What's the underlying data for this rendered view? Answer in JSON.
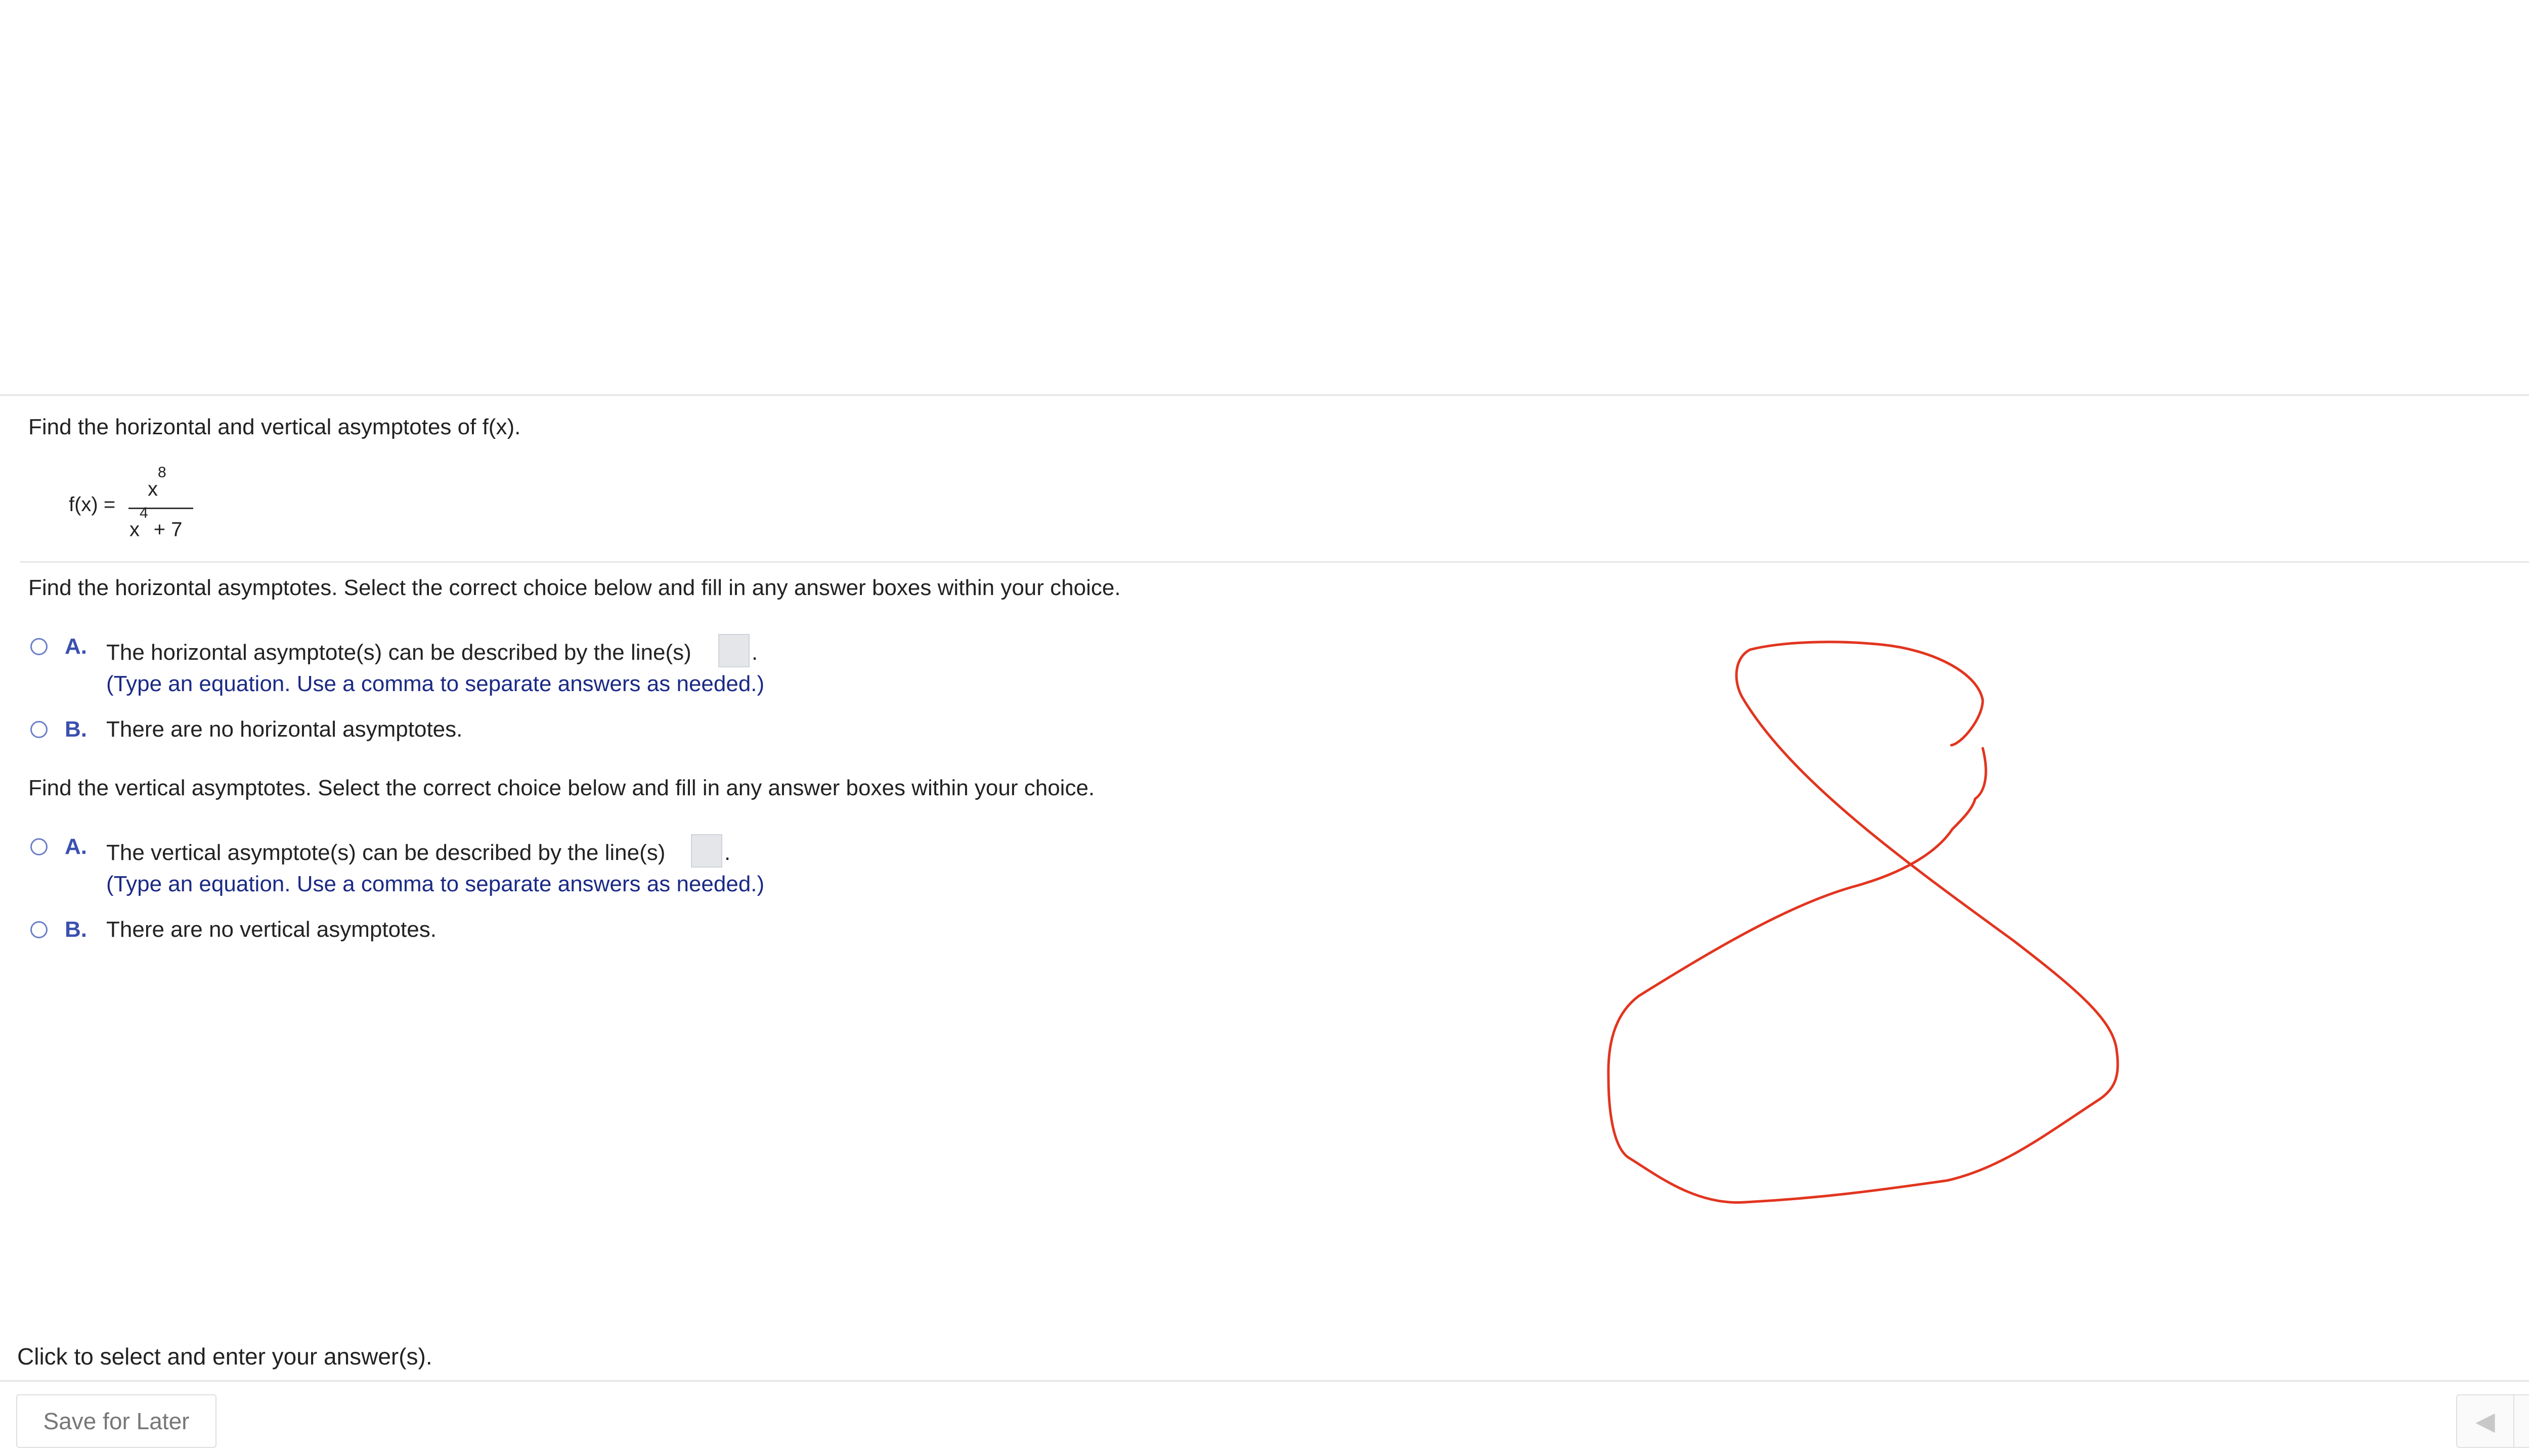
{
  "question": {
    "prompt": "Find the horizontal and vertical asymptotes of f(x).",
    "formula": {
      "label": "f(x) =",
      "numerator_base": "x",
      "numerator_exp": "8",
      "denominator_base": "x",
      "denominator_exp": "4",
      "denominator_rest": " + 7"
    }
  },
  "horizontal": {
    "instruction": "Find the horizontal asymptotes. Select the correct choice below and fill in any answer boxes within your choice.",
    "option_a": {
      "letter": "A.",
      "text": "The horizontal asymptote(s) can be described by the line(s)",
      "suffix": ".",
      "hint": "(Type an equation. Use a comma to separate answers as needed.)"
    },
    "option_b": {
      "letter": "B.",
      "text": "There are no horizontal asymptotes."
    }
  },
  "vertical": {
    "instruction": "Find the vertical asymptotes. Select the correct choice below and fill in any answer boxes within your choice.",
    "option_a": {
      "letter": "A.",
      "text": "The vertical asymptote(s) can be described by the line(s)",
      "suffix": ".",
      "hint": "(Type an equation. Use a comma to separate answers as needed.)"
    },
    "option_b": {
      "letter": "B.",
      "text": "There are no vertical asymptotes."
    }
  },
  "footer": {
    "status": "Click to select and enter your answer(s).",
    "save_label": "Save for Later",
    "help_label": "?",
    "prev_label": "◀",
    "next_label": "▶"
  },
  "colors": {
    "accent": "#3a4fb0",
    "hint_text": "#1b2a86",
    "scribble": "#e2351f",
    "help_bg": "#f2c94c"
  },
  "icons": [
    "gear-icon",
    "help-icon",
    "prev-arrow-icon",
    "next-arrow-icon"
  ]
}
